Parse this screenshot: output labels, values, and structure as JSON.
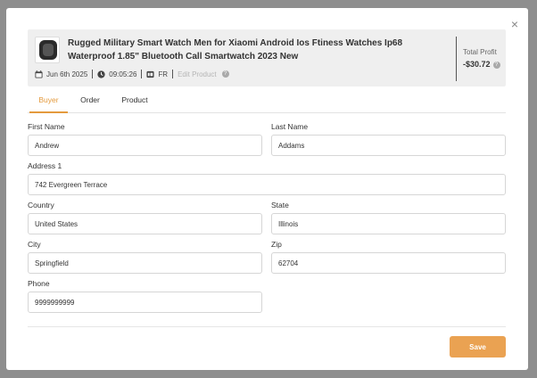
{
  "product": {
    "title": "Rugged Military Smart Watch Men for Xiaomi Android Ios Ftiness Watches Ip68 Waterproof 1.85\" Bluetooth Call Smartwatch 2023 New",
    "date": "Jun 6th 2025",
    "time": "09:05:26",
    "country_code": "FR",
    "edit_link": "Edit Product"
  },
  "profit": {
    "label": "Total Profit",
    "value": "-$30.72"
  },
  "tabs": [
    {
      "label": "Buyer",
      "active": true
    },
    {
      "label": "Order",
      "active": false
    },
    {
      "label": "Product",
      "active": false
    }
  ],
  "form": {
    "first_name": {
      "label": "First Name",
      "value": "Andrew"
    },
    "last_name": {
      "label": "Last Name",
      "value": "Addams"
    },
    "address1": {
      "label": "Address 1",
      "value": "742 Evergreen Terrace"
    },
    "country": {
      "label": "Country",
      "value": "United States"
    },
    "state": {
      "label": "State",
      "value": "Illinois"
    },
    "city": {
      "label": "City",
      "value": "Springfield"
    },
    "zip": {
      "label": "Zip",
      "value": "62704"
    },
    "phone": {
      "label": "Phone",
      "value": "9999999999"
    }
  },
  "actions": {
    "save_label": "Save",
    "close_glyph": "×"
  },
  "colors": {
    "accent": "#e49a3d",
    "save_button": "#eaa252",
    "header_bg": "#efefef"
  },
  "icons": [
    "calendar-icon",
    "clock-icon",
    "flag-icon",
    "help-icon",
    "close-icon",
    "product-thumbnail"
  ]
}
